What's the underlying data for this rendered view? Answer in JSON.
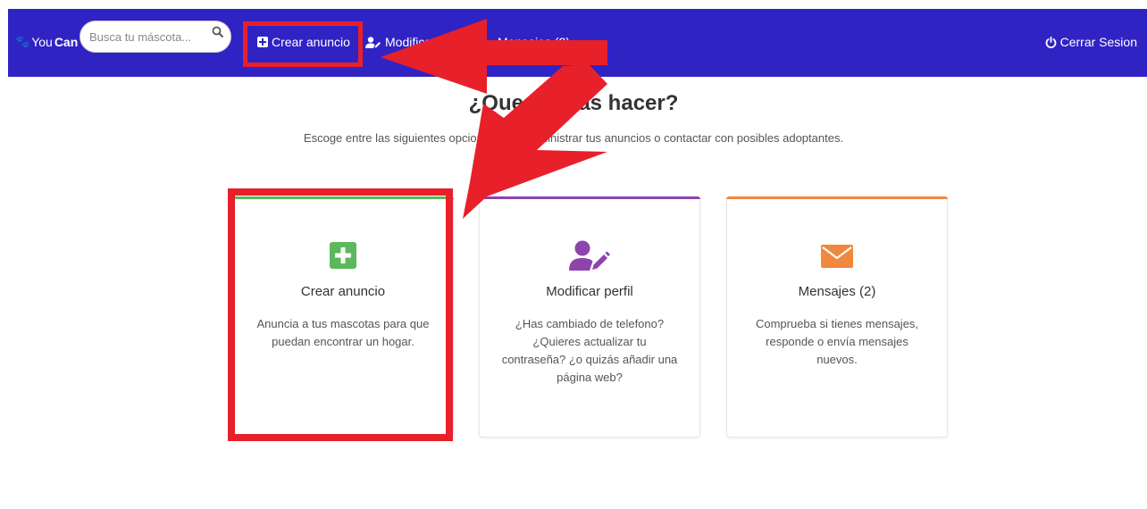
{
  "navbar": {
    "brand_pre": "You",
    "brand_bold": "Can",
    "search_placeholder": "Busca tu máscota...",
    "create_label": "Crear anuncio",
    "profile_label": "Modificar",
    "messages_label": "Mensajes (2)",
    "logout_label": "Cerrar Sesion"
  },
  "main": {
    "heading": "¿Que deseas hacer?",
    "subtext": "Escoge entre las siguientes opciones para administrar tus anuncios o contactar con posibles adoptantes."
  },
  "cards": [
    {
      "title": "Crear anuncio",
      "text": "Anuncia a tus mascotas para que puedan encontrar un hogar.",
      "icon": "plus-square-icon",
      "accent": "#5cb85c"
    },
    {
      "title": "Modificar perfil",
      "text": "¿Has cambiado de telefono? ¿Quieres actualizar tu contraseña? ¿o quizás añadir una página web?",
      "icon": "user-edit-icon",
      "accent": "#8e44ad"
    },
    {
      "title": "Mensajes (2)",
      "text": "Comprueba si tienes mensajes, responde o envía mensajes nuevos.",
      "icon": "envelope-icon",
      "accent": "#f0883e"
    }
  ],
  "colors": {
    "navbar_bg": "#3023c4",
    "annotation_red": "#e8202a"
  }
}
